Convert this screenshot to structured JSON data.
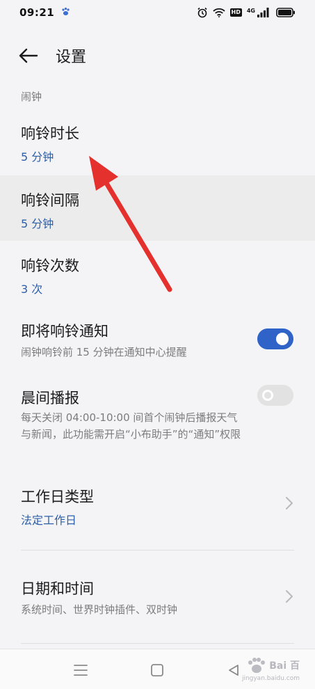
{
  "status_bar": {
    "time": "09:21",
    "hd_label": "HD",
    "network_label": "4G"
  },
  "header": {
    "title": "设置"
  },
  "section": {
    "label": "闹钟"
  },
  "settings": {
    "ring_duration": {
      "title": "响铃时长",
      "value": "5 分钟"
    },
    "ring_interval": {
      "title": "响铃间隔",
      "value": "5 分钟"
    },
    "ring_count": {
      "title": "响铃次数",
      "value": "3 次"
    },
    "upcoming_notice": {
      "title": "即将响铃通知",
      "desc": "闹钟响铃前 15 分钟在通知中心提醒",
      "enabled": true
    },
    "morning_broadcast": {
      "title": "晨间播报",
      "desc": "每天关闭 04:00-10:00 间首个闹钟后播报天气与新闻，此功能需开启“小布助手”的“通知”权限",
      "enabled": false
    },
    "workday_type": {
      "title": "工作日类型",
      "value": "法定工作日"
    },
    "date_time": {
      "title": "日期和时间",
      "desc": "系统时间、世界时钟插件、双时钟"
    }
  },
  "watermark": {
    "logo": "Bai  百",
    "sub": "jingyan.baidu.com"
  },
  "colors": {
    "accent": "#2f63c8",
    "value_text": "#2c5fa8",
    "annotation_arrow": "#e5312d"
  }
}
